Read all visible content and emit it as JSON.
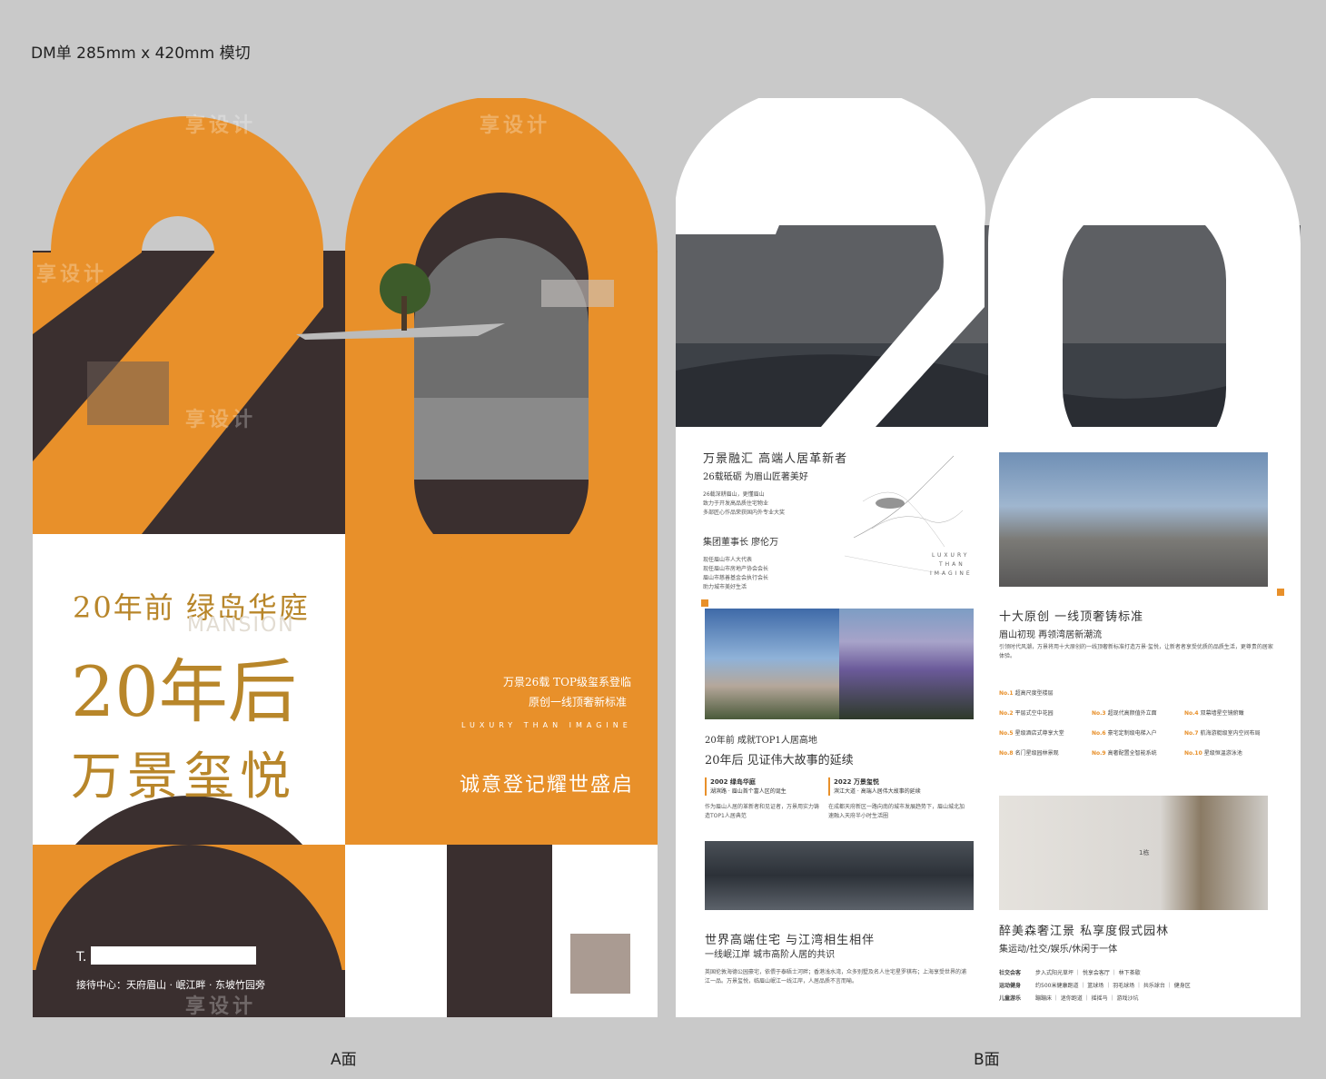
{
  "header": "DM单 285mm x 420mm 模切",
  "labels": {
    "side_a": "A面",
    "side_b": "B面"
  },
  "colors": {
    "orange": "#e8902a",
    "brown": "#3a2f2f",
    "gold": "#b8862a",
    "white": "#ffffff",
    "bg": "#c9c9c9"
  },
  "side_a": {
    "big_number": "20",
    "line1": "20年前 绿岛华庭",
    "mansion": "MANSION",
    "line2": "20年后",
    "line3": "万景玺悦",
    "tagline1": "万景26载 TOP级玺系登临",
    "tagline2": "原创一线顶奢新标准",
    "tagline_en": "LUXURY THAN IMAGINE",
    "slogan": "诚意登记耀世盛启",
    "phone_label": "T.",
    "address": "接待中心：天府眉山 · 岷江畔 · 东坡竹园旁"
  },
  "side_b": {
    "big_number": "20",
    "s1_title": "万景融汇 高端人居革新者",
    "s1_sub": "26载砥砺 为眉山匠著美好",
    "s1_p1": "26载深耕眉山，更懂眉山",
    "s1_p2": "致力于开发高品质住宅物业",
    "s1_p3": "多部匠心作品荣获国内外专业大奖",
    "s1_person": "集团董事长 廖伦万",
    "s1_r1": "现任眉山市人大代表",
    "s1_r2": "现任眉山市房地产协会会长",
    "s1_r3": "眉山市慈善基金会执行会长",
    "s1_r4": "助力城市美好生活",
    "luxury": [
      "LUXURY",
      "THAN",
      "IMAGINE"
    ],
    "s2_title": "十大原创 一线顶奢铸标准",
    "s2_sub": "眉山初现 再领湾居新潮流",
    "s2_desc": "引领时代风潮，万景将用十大原创的一线顶奢新标准打造万景·玺悦，让新者者享受优质的品质生活，更尊贵的居家体验。",
    "features": [
      {
        "no": "No.1",
        "text": "超高尺度型楼层"
      },
      {
        "no": "No.2",
        "text": "平层式空中花园"
      },
      {
        "no": "No.3",
        "text": "超现代高颜值外立面"
      },
      {
        "no": "No.4",
        "text": "双幕墙星空镜俯瞰"
      },
      {
        "no": "No.5",
        "text": "星级酒店式尊享大堂"
      },
      {
        "no": "No.6",
        "text": "豪宅定制级电梯入户"
      },
      {
        "no": "No.7",
        "text": "航海游艇级室内空间布局"
      },
      {
        "no": "No.8",
        "text": "名门星级园林景观"
      },
      {
        "no": "No.9",
        "text": "高奢配置全智能系统"
      },
      {
        "no": "No.10",
        "text": "星级恒温游泳池"
      }
    ],
    "s3_t1": "20年前 成就TOP1人居高地",
    "s3_t2": "20年后 见证伟大故事的延续",
    "s3_y1": "2002 绿岛华庭",
    "s3_y1b": "湖滨路 · 眉山首个富人区的诞生",
    "s3_y2": "2022 万景玺悦",
    "s3_y2b": "滨江大道 · 高端人居伟大故事的延续",
    "s3_p1": "作为眉山人居的革新者和见证者，万景用实力铸造TOP1人居典范",
    "s3_p2": "在成都天府新区一路向南的城市发展趋势下，眉山城北加速融入天府半小时生活圈",
    "s4_title": "世界高端住宅 与江湾相生相伴",
    "s4_sub": "一线岷江岸 城市高阶人居的共识",
    "s4_p": "英国伦敦海德公园豪宅，依偎于泰晤士河畔；香港浅水湾，众多别墅及名人住宅星罗棋布；上海享受世界的浦江一品。万景玺悦，临眉山岷江一线江岸，人居品质不言而喻。",
    "s5_title": "醉美森奢江景 私享度假式园林",
    "s5_sub": "集运动/社交/娱乐/休闲于一体",
    "amenities": [
      {
        "label": "社交会客",
        "items": "步入式阳光草坪 ｜ 悦享会客厅 ｜ 林下茶歇"
      },
      {
        "label": "运动健身",
        "items": "约500米健康跑道 ｜ 篮球场 ｜ 羽毛球场 ｜ 共乐球台 ｜ 健身区"
      },
      {
        "label": "儿童游乐",
        "items": "蹦蹦床 ｜ 迷你跑道 ｜ 摇摇马 ｜ 游戏沙坑"
      }
    ],
    "sign": "1栋"
  },
  "watermark": "享设计"
}
